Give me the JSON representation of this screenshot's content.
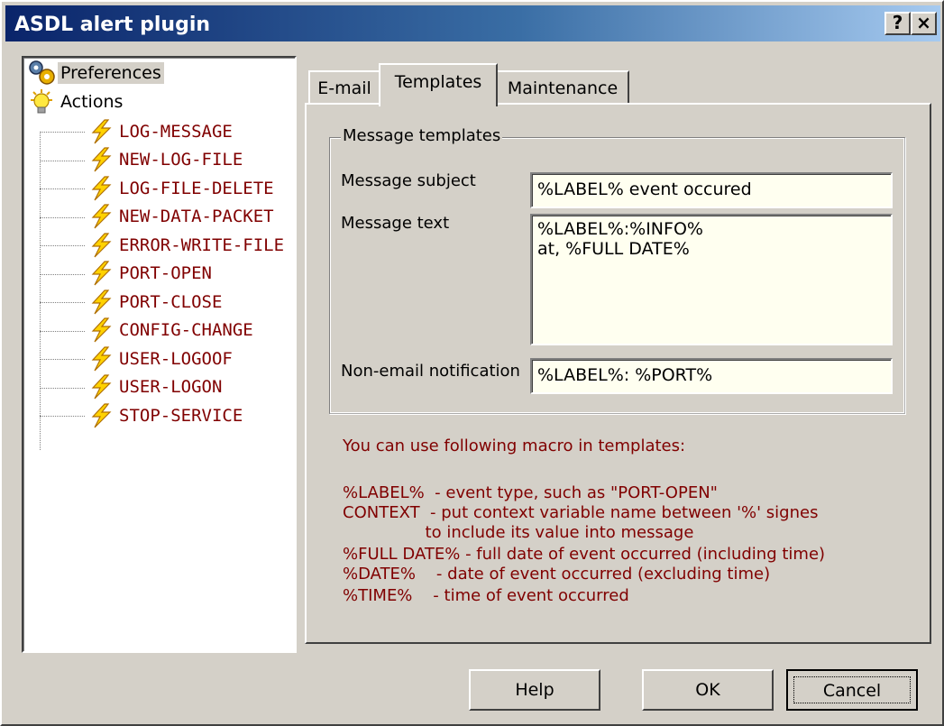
{
  "window": {
    "title": "ASDL alert plugin",
    "help_glyph": "?",
    "close_glyph": "×"
  },
  "tree": {
    "roots": [
      {
        "label": "Preferences",
        "icon": "gears-icon",
        "selected": true
      },
      {
        "label": "Actions",
        "icon": "lightbulb-icon",
        "selected": false
      }
    ],
    "actions": [
      "LOG-MESSAGE",
      "NEW-LOG-FILE",
      "LOG-FILE-DELETE",
      "NEW-DATA-PACKET",
      "ERROR-WRITE-FILE",
      "PORT-OPEN",
      "PORT-CLOSE",
      "CONFIG-CHANGE",
      "USER-LOGOOF",
      "USER-LOGON",
      "STOP-SERVICE"
    ]
  },
  "tabs": [
    {
      "label": "E-mail",
      "active": false
    },
    {
      "label": "Templates",
      "active": true
    },
    {
      "label": "Maintenance",
      "active": false
    }
  ],
  "templates": {
    "group_title": "Message templates",
    "subject_label": "Message subject",
    "subject_value": "%LABEL% event occured",
    "text_label": "Message text",
    "text_value": "%LABEL%:%INFO%\nat, %FULL DATE%",
    "nonemail_label": "Non-email notification",
    "nonemail_value": "%LABEL%: %PORT%"
  },
  "help": {
    "intro": "You can use following macro in templates:",
    "lines": [
      "%LABEL%  - event type, such as \"PORT-OPEN\"",
      "CONTEXT  - put context variable name between '%' signes",
      "                to include its value into message",
      "%FULL DATE% - full date of event occurred (including time)",
      "%DATE%    - date of event occurred (excluding time)",
      "%TIME%    - time of event occurred"
    ]
  },
  "buttons": {
    "help": "Help",
    "ok": "OK",
    "cancel": "Cancel"
  },
  "colors": {
    "face": "#d4d0c8",
    "title_start": "#0a246a",
    "title_end": "#a6caf0",
    "action_text": "#800000",
    "field_bg": "#fffff0"
  }
}
